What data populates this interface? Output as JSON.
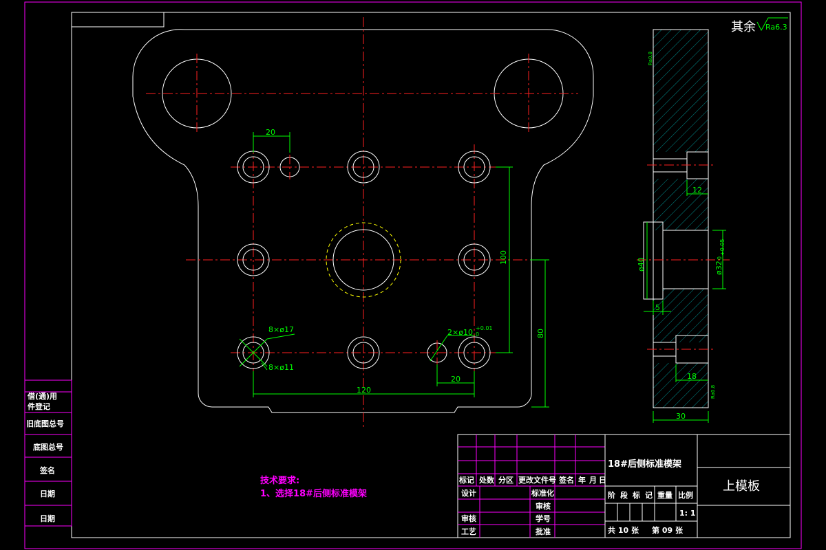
{
  "drawing": {
    "surface_finish": {
      "prefix": "其余",
      "value": "Ra6.3"
    },
    "dimensions": {
      "d20_top": "20",
      "d100": "100",
      "d80": "80",
      "d120": "120",
      "d20_bottom": "20",
      "holes_17": "8×ø17",
      "holes_11": "8×ø11",
      "pin_holes": "2×ø10",
      "pin_tol": "+0.01",
      "pin_tol_low": "0",
      "side_12": "12",
      "side_d40": "ø40",
      "side_d32": "ø32",
      "side_d32_tol_up": "+0.05",
      "side_d32_tol_low": "0",
      "side_5": "5",
      "side_18": "18",
      "side_30": "30",
      "side_ra_top": "Ra0.8",
      "side_ra_bottom": "Ra0.8"
    }
  },
  "left_strip": {
    "labels": [
      "借(通)用",
      "件登记",
      "旧底图总号",
      "底图总号",
      "签名",
      "日期",
      "日期"
    ]
  },
  "tech_req": {
    "title": "技术要求:",
    "item1": "1、选择18#后侧标准模架"
  },
  "title_block": {
    "project_name": "18#后侧标准模架",
    "part_name": "上模板",
    "header_row": [
      "标记",
      "处数",
      "分区",
      "更改文件号",
      "签名",
      "年",
      "月",
      "日"
    ],
    "design": "设计",
    "standardize": "标准化",
    "review_mid": "审核",
    "audit": "审核",
    "craft": "工艺",
    "approve": "批准",
    "student_no": "学号",
    "stage_headers": [
      "阶",
      "段",
      "标",
      "记",
      "重量",
      "比例"
    ],
    "scale": "1: 1",
    "sheets_total": "共 10 张",
    "sheet_no": "第 09 张"
  }
}
